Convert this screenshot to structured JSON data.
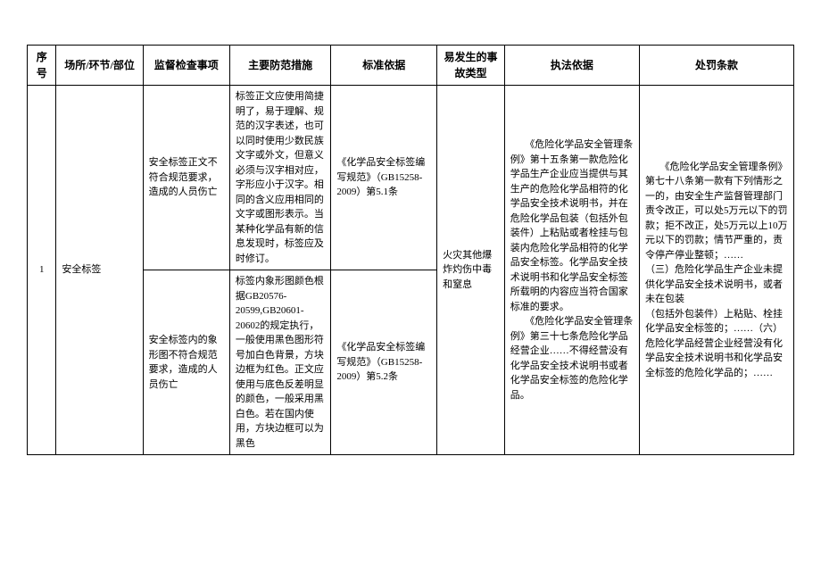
{
  "headers": {
    "seq": "序号",
    "place": "场所/环节/部位",
    "check": "监督检查事项",
    "measure": "主要防范措施",
    "standard": "标准依据",
    "accident": "易发生的事故类型",
    "law": "执法依据",
    "penalty": "处罚条款"
  },
  "row": {
    "seq": "1",
    "place": "安全标签",
    "check1": "安全标签正文不符合规范要求，造成的人员伤亡",
    "measure1": "标签正文应使用简捷明了，易于理解、规范的汉字表述，也可以同时使用少数民族文字或外文，但意义必须与汉字相对应，字形应小于汉字。相同的含义应用相同的文字或图形表示。当某种化学品有新的信息发现时，标签应及时修订。",
    "standard1": "《化学品安全标签编写规范》（GB15258-2009）第5.1条",
    "check2": "安全标签内的象形图不符合规范要求，造成的人员伤亡",
    "measure2": "标签内象形图颜色根据GB20576-20599,GB20601-20602的规定执行，一般使用黑色图形符号加白色背景，方块边框为红色。正文应使用与底色反差明显的颜色，一般采用黑白色。若在国内使用，方块边框可以为黑色",
    "standard2": "《化学品安全标签编写规范》（GB15258-2009）第5.2条",
    "accident": "火灾其他爆炸灼伤中毒和窒息",
    "law": "　　《危险化学品安全管理条例》第十五条第一款危险化学品生产企业应当提供与其生产的危险化学品相符的化学品安全技术说明书，并在危险化学品包装（包括外包装件）上粘贴或者栓挂与包装内危险化学品相符的化学品安全标签。化学品安全技术说明书和化学品安全标签所载明的内容应当符合国家标准的要求。\n　　《危险化学品安全管理条例》第三十七条危险化学品经营企业……不得经营没有化学品安全技术说明书或者化学品安全标签的危险化学品。",
    "penalty": "　　《危险化学品安全管理条例》第七十八条第一款有下列情形之一的，由安全生产监督管理部门责令改正，可以处5万元以下的罚款；拒不改正，处5万元以上10万元以下的罚款；情节严重的，责令停产停业整顿；……\n（三）危险化学品生产企业未提供化学品安全技术说明书，或者未在包装\n（包括外包装件）上粘贴、栓挂化学品安全标签的；……（六）危险化学品经营企业经营没有化学品安全技术说明书和化学品安全标签的危险化学品的；……"
  }
}
